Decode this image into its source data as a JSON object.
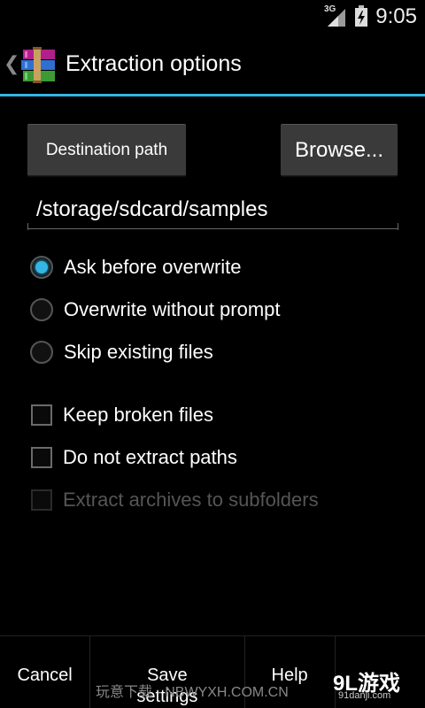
{
  "status_bar": {
    "network": "3G",
    "time": "9:05"
  },
  "action_bar": {
    "up_icon": "chevron-left-icon",
    "app_icon": "winrar-books-icon",
    "title": "Extraction options"
  },
  "destination": {
    "label_button": "Destination path",
    "browse_button": "Browse...",
    "path_value": "/storage/sdcard/samples"
  },
  "overwrite_options": [
    {
      "label": "Ask before overwrite",
      "checked": true
    },
    {
      "label": "Overwrite without prompt",
      "checked": false
    },
    {
      "label": "Skip existing files",
      "checked": false
    }
  ],
  "checkbox_options": [
    {
      "label": "Keep broken files",
      "checked": false,
      "enabled": true
    },
    {
      "label": "Do not extract paths",
      "checked": false,
      "enabled": true
    },
    {
      "label": "Extract archives to subfolders",
      "checked": false,
      "enabled": false
    }
  ],
  "bottom_bar": {
    "cancel": "Cancel",
    "save_settings": "Save settings",
    "help": "Help"
  },
  "watermark": {
    "text": "玩意下载 · NBWYXH.COM.CN",
    "logo": "9L游戏",
    "sub": "91danji.com"
  },
  "colors": {
    "accent": "#33b5e5",
    "background": "#000000",
    "button": "#3a3a3a"
  }
}
